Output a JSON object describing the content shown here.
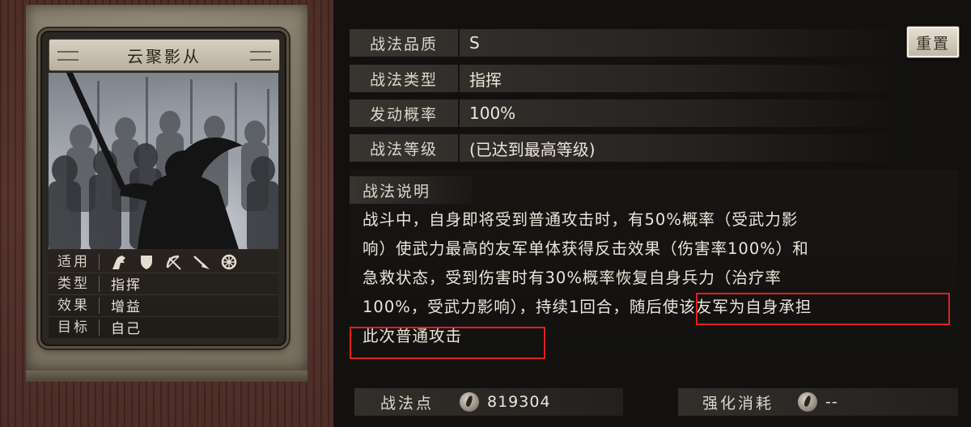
{
  "card": {
    "name": "云聚影从",
    "attrs": {
      "apply_label": "适用",
      "apply_icons": [
        "cavalry-icon",
        "shield-icon",
        "bow-icon",
        "spear-icon",
        "wheel-icon"
      ],
      "type_label": "类型",
      "type_value": "指挥",
      "effect_label": "效果",
      "effect_value": "增益",
      "target_label": "目标",
      "target_value": "自己"
    }
  },
  "info": {
    "quality_label": "战法品质",
    "quality_value": "S",
    "kind_label": "战法类型",
    "kind_value": "指挥",
    "rate_label": "发动概率",
    "rate_value": "100%",
    "level_label": "战法等级",
    "level_value": "(已达到最高等级)",
    "reset_label": "重置"
  },
  "description": {
    "title": "战法说明",
    "lines": [
      "战斗中，自身即将受到普通攻击时，有50%概率（受武力影",
      "响）使武力最高的友军单体获得反击效果（伤害率100%）和",
      "急救状态，受到伤害时有30%概率恢复自身兵力（治疗率",
      "100%，受武力影响），持续1回合，",
      "此次普通攻击"
    ],
    "line4_highlight": "随后使该友军为自身承担"
  },
  "footer": {
    "points_label": "战法点",
    "points_value": "819304",
    "cost_label": "强化消耗",
    "cost_value": "--"
  },
  "colors": {
    "highlight_border": "#e11e1e",
    "scroll_wood": "#54302a"
  }
}
